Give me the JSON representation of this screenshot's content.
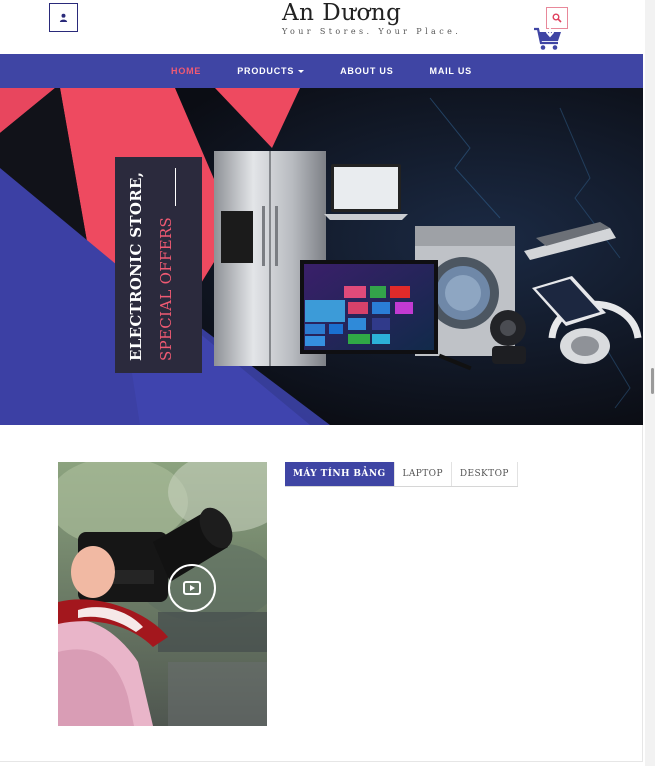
{
  "header": {
    "brand_name": "An Dương",
    "brand_tagline": "Your Stores. Your Place.",
    "user_icon": "user-icon",
    "search_icon": "search-icon",
    "cart_icon": "cart-icon"
  },
  "nav": {
    "items": [
      {
        "label": "HOME",
        "active": true
      },
      {
        "label": "PRODUCTS",
        "dropdown": true
      },
      {
        "label": "ABOUT US"
      },
      {
        "label": "MAIL US"
      }
    ]
  },
  "banner": {
    "line1": "ELECTRONIC STORE,",
    "line2": "SPECIAL OFFERS"
  },
  "content": {
    "play_icon": "play-icon",
    "tabs": [
      {
        "label": "MÁY TÍNH BẢNG",
        "active": true
      },
      {
        "label": "LAPTOP"
      },
      {
        "label": "DESKTOP"
      }
    ]
  },
  "colors": {
    "nav_bg": "#3f45a4",
    "accent_pink": "#f05a73",
    "banner_dark": "#0f1118"
  }
}
